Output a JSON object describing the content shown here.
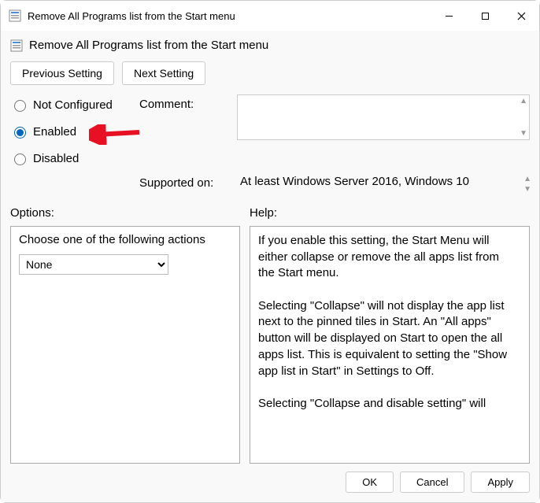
{
  "window": {
    "title": "Remove All Programs list from the Start menu"
  },
  "header": {
    "title": "Remove All Programs list from the Start menu"
  },
  "nav": {
    "prev": "Previous Setting",
    "next": "Next Setting"
  },
  "state": {
    "not_configured": "Not Configured",
    "enabled": "Enabled",
    "disabled": "Disabled",
    "selected": "enabled"
  },
  "labels": {
    "comment": "Comment:",
    "supported": "Supported on:",
    "options": "Options:",
    "help": "Help:"
  },
  "comment": "",
  "supported_on": "At least Windows Server 2016, Windows 10",
  "options": {
    "prompt": "Choose one of the following actions",
    "selected": "None",
    "items": [
      "None"
    ]
  },
  "help_text": "If you enable this setting, the Start Menu will either collapse or remove the all apps list from the Start menu.\n\nSelecting \"Collapse\" will not display the app list next to the pinned tiles in Start. An \"All apps\" button will be displayed on Start to open the all apps list. This is equivalent to setting the \"Show app list in Start\" in Settings to Off.\n\nSelecting \"Collapse and disable setting\" will",
  "footer": {
    "ok": "OK",
    "cancel": "Cancel",
    "apply": "Apply"
  }
}
